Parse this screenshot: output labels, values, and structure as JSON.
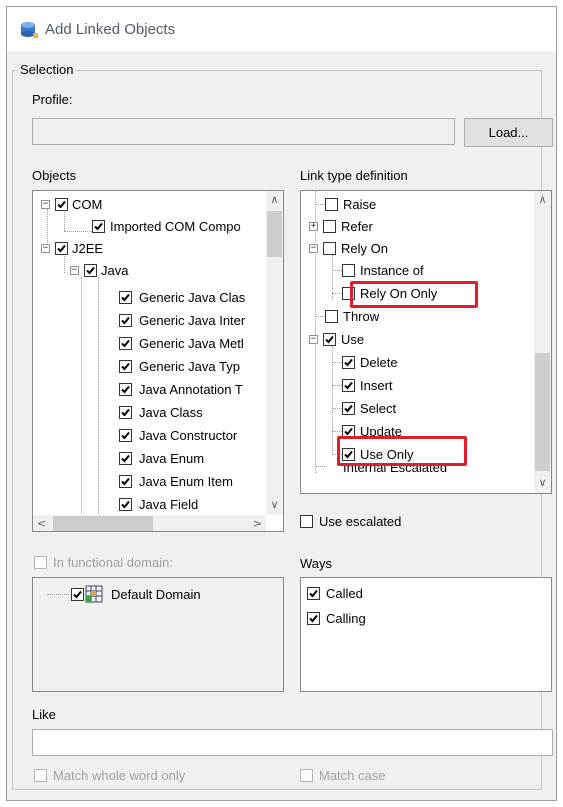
{
  "window": {
    "title": "Add Linked Objects",
    "icon": "database-icon"
  },
  "selection": {
    "group_label": "Selection",
    "profile_label": "Profile:",
    "profile_value": "",
    "load_button": "Load..."
  },
  "objects": {
    "label": "Objects",
    "items": [
      "COM",
      "Imported COM Compo",
      "J2EE",
      "Java",
      "Generic Java Clas",
      "Generic Java Inter",
      "Generic Java Metl",
      "Generic Java Typ",
      "Java Annotation T",
      "Java Class",
      "Java Constructor",
      "Java Enum",
      "Java Enum Item",
      "Java Field"
    ]
  },
  "link_types": {
    "label": "Link type definition",
    "items": [
      "Raise",
      "Refer",
      "Rely On",
      "Instance of",
      "Rely On Only",
      "Throw",
      "Use",
      "Delete",
      "Insert",
      "Select",
      "Update",
      "Use Only",
      "Internal Escalated"
    ],
    "use_escalated": "Use escalated"
  },
  "functional_domain": {
    "label": "In functional domain:",
    "items": [
      "Default Domain"
    ]
  },
  "ways": {
    "label": "Ways",
    "items": [
      "Called",
      "Calling"
    ]
  },
  "like": {
    "label": "Like",
    "value": "",
    "match_whole_word": "Match whole word only",
    "match_case": "Match case"
  },
  "colors": {
    "highlight": "#e01e2a",
    "window_bg": "#f0f0f0"
  }
}
